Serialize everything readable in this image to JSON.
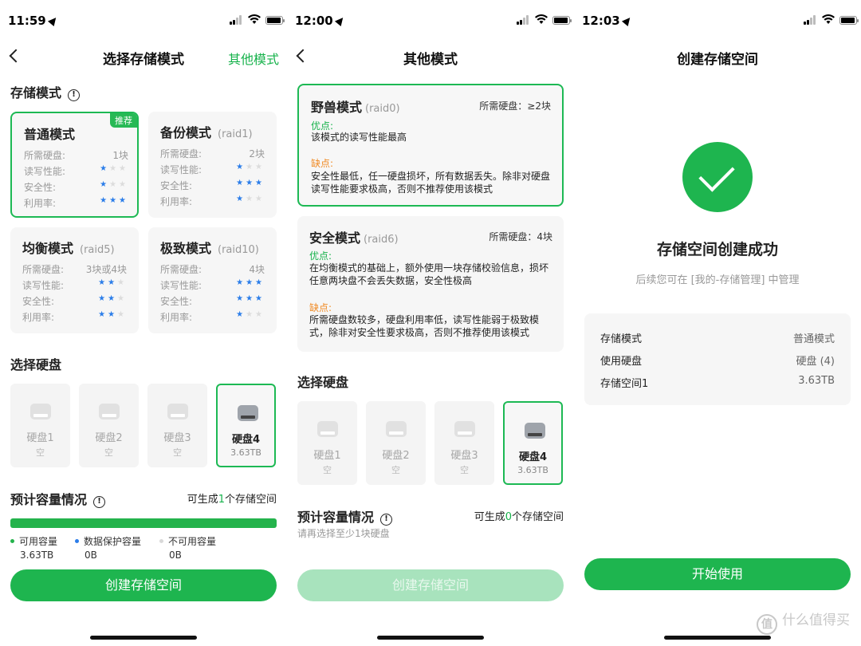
{
  "screen1": {
    "time": "11:59",
    "title": "选择存储模式",
    "nav_right": "其他模式",
    "section_mode": "存储模式",
    "modes": [
      {
        "name": "普通模式",
        "raid": "",
        "badge": "推荐",
        "labels": [
          "所需硬盘:",
          "读写性能:",
          "安全性:",
          "利用率:"
        ],
        "disks": "1块",
        "perf": 1,
        "safety": 1,
        "util": 3
      },
      {
        "name": "备份模式",
        "raid": "(raid1)",
        "labels": [
          "所需硬盘:",
          "读写性能:",
          "安全性:",
          "利用率:"
        ],
        "disks": "2块",
        "perf": 1,
        "safety": 3,
        "util": 1
      },
      {
        "name": "均衡模式",
        "raid": "(raid5)",
        "labels": [
          "所需硬盘:",
          "读写性能:",
          "安全性:",
          "利用率:"
        ],
        "disks": "3块或4块",
        "perf": 2,
        "safety": 2,
        "util": 2
      },
      {
        "name": "极致模式",
        "raid": "(raid10)",
        "labels": [
          "所需硬盘:",
          "读写性能:",
          "安全性:",
          "利用率:"
        ],
        "disks": "4块",
        "perf": 3,
        "safety": 3,
        "util": 1
      }
    ],
    "section_disk": "选择硬盘",
    "disks": [
      {
        "name": "硬盘1",
        "sub": "空"
      },
      {
        "name": "硬盘2",
        "sub": "空"
      },
      {
        "name": "硬盘3",
        "sub": "空"
      },
      {
        "name": "硬盘4",
        "sub": "3.63TB"
      }
    ],
    "section_capacity": "预计容量情况",
    "capacity_prefix": "可生成",
    "capacity_count": "1",
    "capacity_suffix": "个存储空间",
    "legend": [
      {
        "label": "可用容量",
        "value": "3.63TB",
        "color": "#24b34c"
      },
      {
        "label": "数据保护容量",
        "value": "0B",
        "color": "#2b7de9"
      },
      {
        "label": "不可用容量",
        "value": "0B",
        "color": "#d9d9d9"
      }
    ],
    "button": "创建存储空间"
  },
  "screen2": {
    "time": "12:00",
    "title": "其他模式",
    "modes": [
      {
        "name": "野兽模式",
        "raid": "(raid0)",
        "req": "所需硬盘：≥2块",
        "pros_label": "优点:",
        "pros": "该模式的读写性能最高",
        "cons_label": "缺点:",
        "cons": "安全性最低，任一硬盘损坏，所有数据丢失。除非对硬盘读写性能要求极高，否则不推荐使用该模式"
      },
      {
        "name": "安全模式",
        "raid": "(raid6)",
        "req": "所需硬盘：4块",
        "pros_label": "优点:",
        "pros": "在均衡模式的基础上，额外使用一块存储校验信息，损坏任意两块盘不会丢失数据，安全性极高",
        "cons_label": "缺点:",
        "cons": "所需硬盘数较多，硬盘利用率低，读写性能弱于极致模式，除非对安全性要求极高，否则不推荐使用该模式"
      }
    ],
    "section_disk": "选择硬盘",
    "disks": [
      {
        "name": "硬盘1",
        "sub": "空"
      },
      {
        "name": "硬盘2",
        "sub": "空"
      },
      {
        "name": "硬盘3",
        "sub": "空"
      },
      {
        "name": "硬盘4",
        "sub": "3.63TB"
      }
    ],
    "section_capacity": "预计容量情况",
    "capacity_prefix": "可生成",
    "capacity_count": "0",
    "capacity_suffix": "个存储空间",
    "hint": "请再选择至少1块硬盘",
    "button": "创建存储空间"
  },
  "screen3": {
    "time": "12:03",
    "title": "创建存储空间",
    "success_title": "存储空间创建成功",
    "success_sub": "后续您可在 [我的-存储管理] 中管理",
    "summary": [
      {
        "key": "存储模式",
        "value": "普通模式"
      },
      {
        "key": "使用硬盘",
        "value": "硬盘 (4)"
      },
      {
        "key": "存储空间1",
        "value": "3.63TB"
      }
    ],
    "button": "开始使用",
    "watermark": "什么值得买",
    "watermark_logo": "值"
  },
  "colors": {
    "accent": "#1eb54f",
    "star": "#2b7de9",
    "cons": "#f08a24"
  }
}
